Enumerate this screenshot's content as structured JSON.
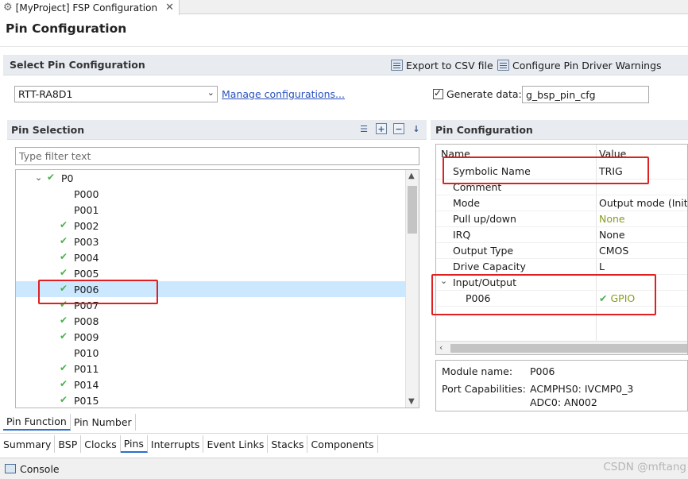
{
  "editor_tab": {
    "title": "[MyProject] FSP Configuration",
    "close": "✕"
  },
  "page_title": "Pin Configuration",
  "select_section": {
    "title": "Select Pin Configuration",
    "export_label": "Export to CSV file",
    "warnings_label": "Configure Pin Driver Warnings",
    "config_value": "RTT-RA8D1",
    "manage_link": "Manage configurations...",
    "generate_label": "Generate data:",
    "generate_checked": true,
    "generate_value": "g_bsp_pin_cfg"
  },
  "pin_selection": {
    "title": "Pin Selection",
    "filter_placeholder": "Type filter text",
    "group": {
      "label": "P0",
      "checked": true,
      "expanded": true
    },
    "pins": [
      {
        "label": "P000",
        "checked": false,
        "selected": false
      },
      {
        "label": "P001",
        "checked": false,
        "selected": false
      },
      {
        "label": "P002",
        "checked": true,
        "selected": false
      },
      {
        "label": "P003",
        "checked": true,
        "selected": false
      },
      {
        "label": "P004",
        "checked": true,
        "selected": false
      },
      {
        "label": "P005",
        "checked": true,
        "selected": false
      },
      {
        "label": "P006",
        "checked": true,
        "selected": true
      },
      {
        "label": "P007",
        "checked": true,
        "selected": false
      },
      {
        "label": "P008",
        "checked": true,
        "selected": false
      },
      {
        "label": "P009",
        "checked": true,
        "selected": false
      },
      {
        "label": "P010",
        "checked": false,
        "selected": false
      },
      {
        "label": "P011",
        "checked": true,
        "selected": false
      },
      {
        "label": "P014",
        "checked": true,
        "selected": false
      },
      {
        "label": "P015",
        "checked": true,
        "selected": false
      }
    ]
  },
  "pin_configuration": {
    "title": "Pin Configuration",
    "col_name": "Name",
    "col_value": "Value",
    "rows": [
      {
        "name": "Symbolic Name",
        "value": "TRIG"
      },
      {
        "name": "Comment",
        "value": ""
      },
      {
        "name": "Mode",
        "value": "Output mode (Initial Low)"
      },
      {
        "name": "Pull up/down",
        "value": "None",
        "value_color": "#8a9a1e"
      },
      {
        "name": "IRQ",
        "value": "None"
      },
      {
        "name": "Output Type",
        "value": "CMOS"
      },
      {
        "name": "Drive Capacity",
        "value": "L"
      }
    ],
    "io_group": {
      "label": "Input/Output"
    },
    "io_pin": {
      "name": "P006",
      "value": "GPIO",
      "value_color": "#8a9a1e"
    }
  },
  "info": {
    "module_label": "Module name:",
    "module_value": "P006",
    "port_label": "Port Capabilities:",
    "port_value_1": "ACMPHS0: IVCMP0_3",
    "port_value_2": "ADC0: AN002"
  },
  "function_tabs": [
    "Pin Function",
    "Pin Number"
  ],
  "page_tabs": [
    "Summary",
    "BSP",
    "Clocks",
    "Pins",
    "Interrupts",
    "Event Links",
    "Stacks",
    "Components"
  ],
  "active_page_tab": "Pins",
  "console_label": "Console",
  "watermark": "CSDN @mftang",
  "colors": {
    "accent": "#2a6fcf",
    "check_green": "#4caf50",
    "annotation_red": "#e02020",
    "selection": "#cce8ff"
  }
}
